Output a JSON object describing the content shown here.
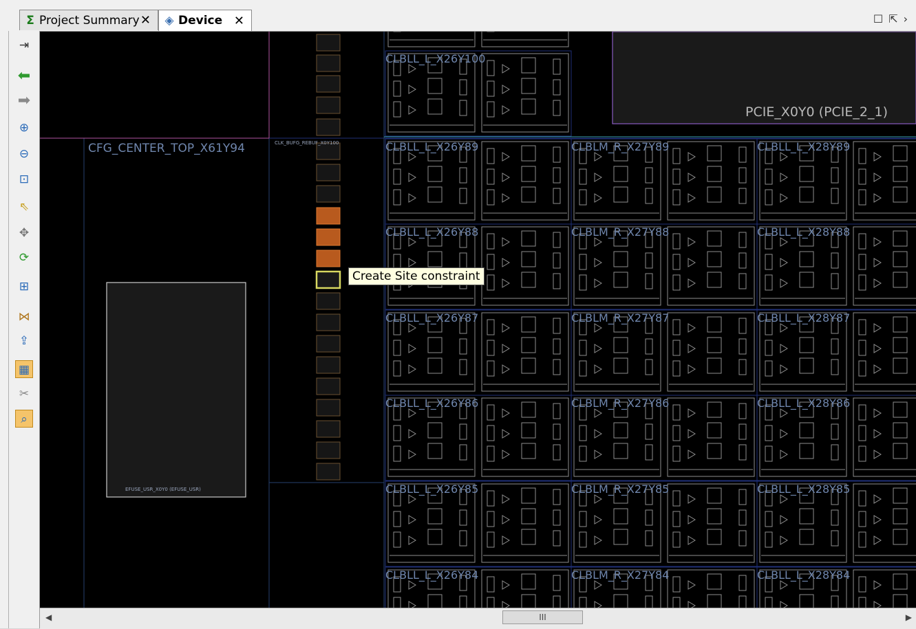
{
  "tabs": [
    {
      "label": "Project Summary",
      "icon": "sigma-icon",
      "close": "✕"
    },
    {
      "label": "Device",
      "icon": "device-icon",
      "close": "✕"
    }
  ],
  "window_controls": {
    "restore": "☐",
    "float": "⇱",
    "more": "›"
  },
  "toolbar_buttons": [
    "auto-fit-icon",
    "back-arrow-icon",
    "forward-arrow-icon",
    "zoom-in-icon",
    "zoom-out-icon",
    "zoom-fit-icon",
    "select-icon",
    "pan-icon",
    "refresh-icon",
    "add-pblock-icon",
    "routing-icon",
    "place-icon",
    "highlight-icon",
    "unplace-icon",
    "search-icon"
  ],
  "device": {
    "cfg_label": "CFG_CENTER_TOP_X61Y94",
    "clk_label": "CLK_BUFG_REBUF_X0Y100",
    "efuse_label": "EFUSE_USR_X0Y0 (EFUSE_USR)",
    "pcie_label": "PCIE_X0Y0 (PCIE_2_1)",
    "rows": [
      {
        "labels": [
          "CLBLL_L_X26Y100"
        ]
      },
      {
        "labels": [
          "CLBLL_L_X26Y89",
          "CLBLM_R_X27Y89",
          "CLBLL_L_X28Y89"
        ]
      },
      {
        "labels": [
          "CLBLL_L_X26Y88",
          "CLBLM_R_X27Y88",
          "CLBLL_L_X28Y88"
        ]
      },
      {
        "labels": [
          "CLBLL_L_X26Y87",
          "CLBLM_R_X27Y87",
          "CLBLL_L_X28Y87"
        ]
      },
      {
        "labels": [
          "CLBLL_L_X26Y86",
          "CLBLM_R_X27Y86",
          "CLBLL_L_X28Y86"
        ]
      },
      {
        "labels": [
          "CLBLL_L_X26Y85",
          "CLBLM_R_X27Y85",
          "CLBLL_L_X28Y85"
        ]
      },
      {
        "labels": [
          "CLBLL_L_X26Y84",
          "CLBLM_R_X27Y84",
          "CLBLL_L_X28Y84"
        ]
      }
    ]
  },
  "tooltip": "Create Site constraint",
  "scrollbar": {
    "thumb_label": "III",
    "left_arrow": "◀",
    "right_arrow": "▶"
  }
}
